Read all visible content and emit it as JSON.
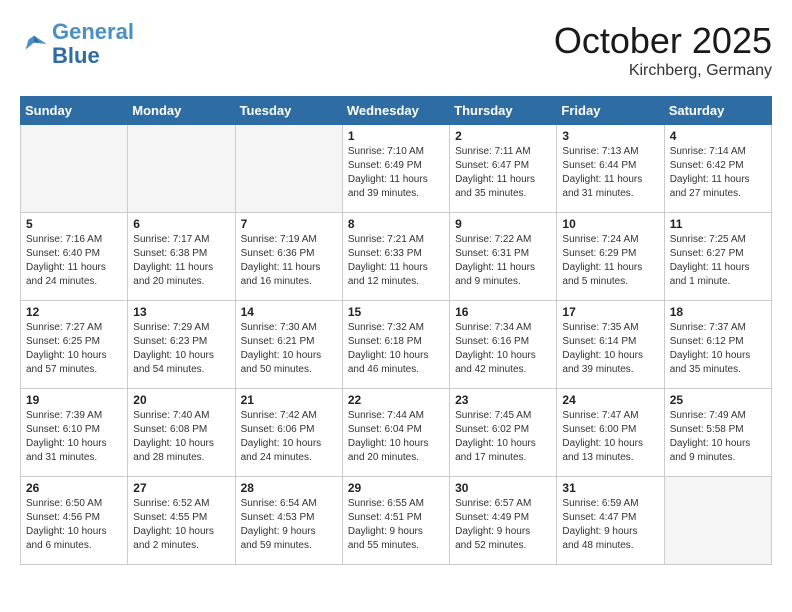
{
  "logo": {
    "general": "General",
    "blue": "Blue"
  },
  "title": "October 2025",
  "location": "Kirchberg, Germany",
  "weekdays": [
    "Sunday",
    "Monday",
    "Tuesday",
    "Wednesday",
    "Thursday",
    "Friday",
    "Saturday"
  ],
  "rows": [
    [
      {
        "day": "",
        "info": "",
        "empty": true
      },
      {
        "day": "",
        "info": "",
        "empty": true
      },
      {
        "day": "",
        "info": "",
        "empty": true
      },
      {
        "day": "1",
        "info": "Sunrise: 7:10 AM\nSunset: 6:49 PM\nDaylight: 11 hours\nand 39 minutes."
      },
      {
        "day": "2",
        "info": "Sunrise: 7:11 AM\nSunset: 6:47 PM\nDaylight: 11 hours\nand 35 minutes."
      },
      {
        "day": "3",
        "info": "Sunrise: 7:13 AM\nSunset: 6:44 PM\nDaylight: 11 hours\nand 31 minutes."
      },
      {
        "day": "4",
        "info": "Sunrise: 7:14 AM\nSunset: 6:42 PM\nDaylight: 11 hours\nand 27 minutes."
      }
    ],
    [
      {
        "day": "5",
        "info": "Sunrise: 7:16 AM\nSunset: 6:40 PM\nDaylight: 11 hours\nand 24 minutes."
      },
      {
        "day": "6",
        "info": "Sunrise: 7:17 AM\nSunset: 6:38 PM\nDaylight: 11 hours\nand 20 minutes."
      },
      {
        "day": "7",
        "info": "Sunrise: 7:19 AM\nSunset: 6:36 PM\nDaylight: 11 hours\nand 16 minutes."
      },
      {
        "day": "8",
        "info": "Sunrise: 7:21 AM\nSunset: 6:33 PM\nDaylight: 11 hours\nand 12 minutes."
      },
      {
        "day": "9",
        "info": "Sunrise: 7:22 AM\nSunset: 6:31 PM\nDaylight: 11 hours\nand 9 minutes."
      },
      {
        "day": "10",
        "info": "Sunrise: 7:24 AM\nSunset: 6:29 PM\nDaylight: 11 hours\nand 5 minutes."
      },
      {
        "day": "11",
        "info": "Sunrise: 7:25 AM\nSunset: 6:27 PM\nDaylight: 11 hours\nand 1 minute."
      }
    ],
    [
      {
        "day": "12",
        "info": "Sunrise: 7:27 AM\nSunset: 6:25 PM\nDaylight: 10 hours\nand 57 minutes."
      },
      {
        "day": "13",
        "info": "Sunrise: 7:29 AM\nSunset: 6:23 PM\nDaylight: 10 hours\nand 54 minutes."
      },
      {
        "day": "14",
        "info": "Sunrise: 7:30 AM\nSunset: 6:21 PM\nDaylight: 10 hours\nand 50 minutes."
      },
      {
        "day": "15",
        "info": "Sunrise: 7:32 AM\nSunset: 6:18 PM\nDaylight: 10 hours\nand 46 minutes."
      },
      {
        "day": "16",
        "info": "Sunrise: 7:34 AM\nSunset: 6:16 PM\nDaylight: 10 hours\nand 42 minutes."
      },
      {
        "day": "17",
        "info": "Sunrise: 7:35 AM\nSunset: 6:14 PM\nDaylight: 10 hours\nand 39 minutes."
      },
      {
        "day": "18",
        "info": "Sunrise: 7:37 AM\nSunset: 6:12 PM\nDaylight: 10 hours\nand 35 minutes."
      }
    ],
    [
      {
        "day": "19",
        "info": "Sunrise: 7:39 AM\nSunset: 6:10 PM\nDaylight: 10 hours\nand 31 minutes."
      },
      {
        "day": "20",
        "info": "Sunrise: 7:40 AM\nSunset: 6:08 PM\nDaylight: 10 hours\nand 28 minutes."
      },
      {
        "day": "21",
        "info": "Sunrise: 7:42 AM\nSunset: 6:06 PM\nDaylight: 10 hours\nand 24 minutes."
      },
      {
        "day": "22",
        "info": "Sunrise: 7:44 AM\nSunset: 6:04 PM\nDaylight: 10 hours\nand 20 minutes."
      },
      {
        "day": "23",
        "info": "Sunrise: 7:45 AM\nSunset: 6:02 PM\nDaylight: 10 hours\nand 17 minutes."
      },
      {
        "day": "24",
        "info": "Sunrise: 7:47 AM\nSunset: 6:00 PM\nDaylight: 10 hours\nand 13 minutes."
      },
      {
        "day": "25",
        "info": "Sunrise: 7:49 AM\nSunset: 5:58 PM\nDaylight: 10 hours\nand 9 minutes."
      }
    ],
    [
      {
        "day": "26",
        "info": "Sunrise: 6:50 AM\nSunset: 4:56 PM\nDaylight: 10 hours\nand 6 minutes."
      },
      {
        "day": "27",
        "info": "Sunrise: 6:52 AM\nSunset: 4:55 PM\nDaylight: 10 hours\nand 2 minutes."
      },
      {
        "day": "28",
        "info": "Sunrise: 6:54 AM\nSunset: 4:53 PM\nDaylight: 9 hours\nand 59 minutes."
      },
      {
        "day": "29",
        "info": "Sunrise: 6:55 AM\nSunset: 4:51 PM\nDaylight: 9 hours\nand 55 minutes."
      },
      {
        "day": "30",
        "info": "Sunrise: 6:57 AM\nSunset: 4:49 PM\nDaylight: 9 hours\nand 52 minutes."
      },
      {
        "day": "31",
        "info": "Sunrise: 6:59 AM\nSunset: 4:47 PM\nDaylight: 9 hours\nand 48 minutes."
      },
      {
        "day": "",
        "info": "",
        "empty": true
      }
    ]
  ]
}
